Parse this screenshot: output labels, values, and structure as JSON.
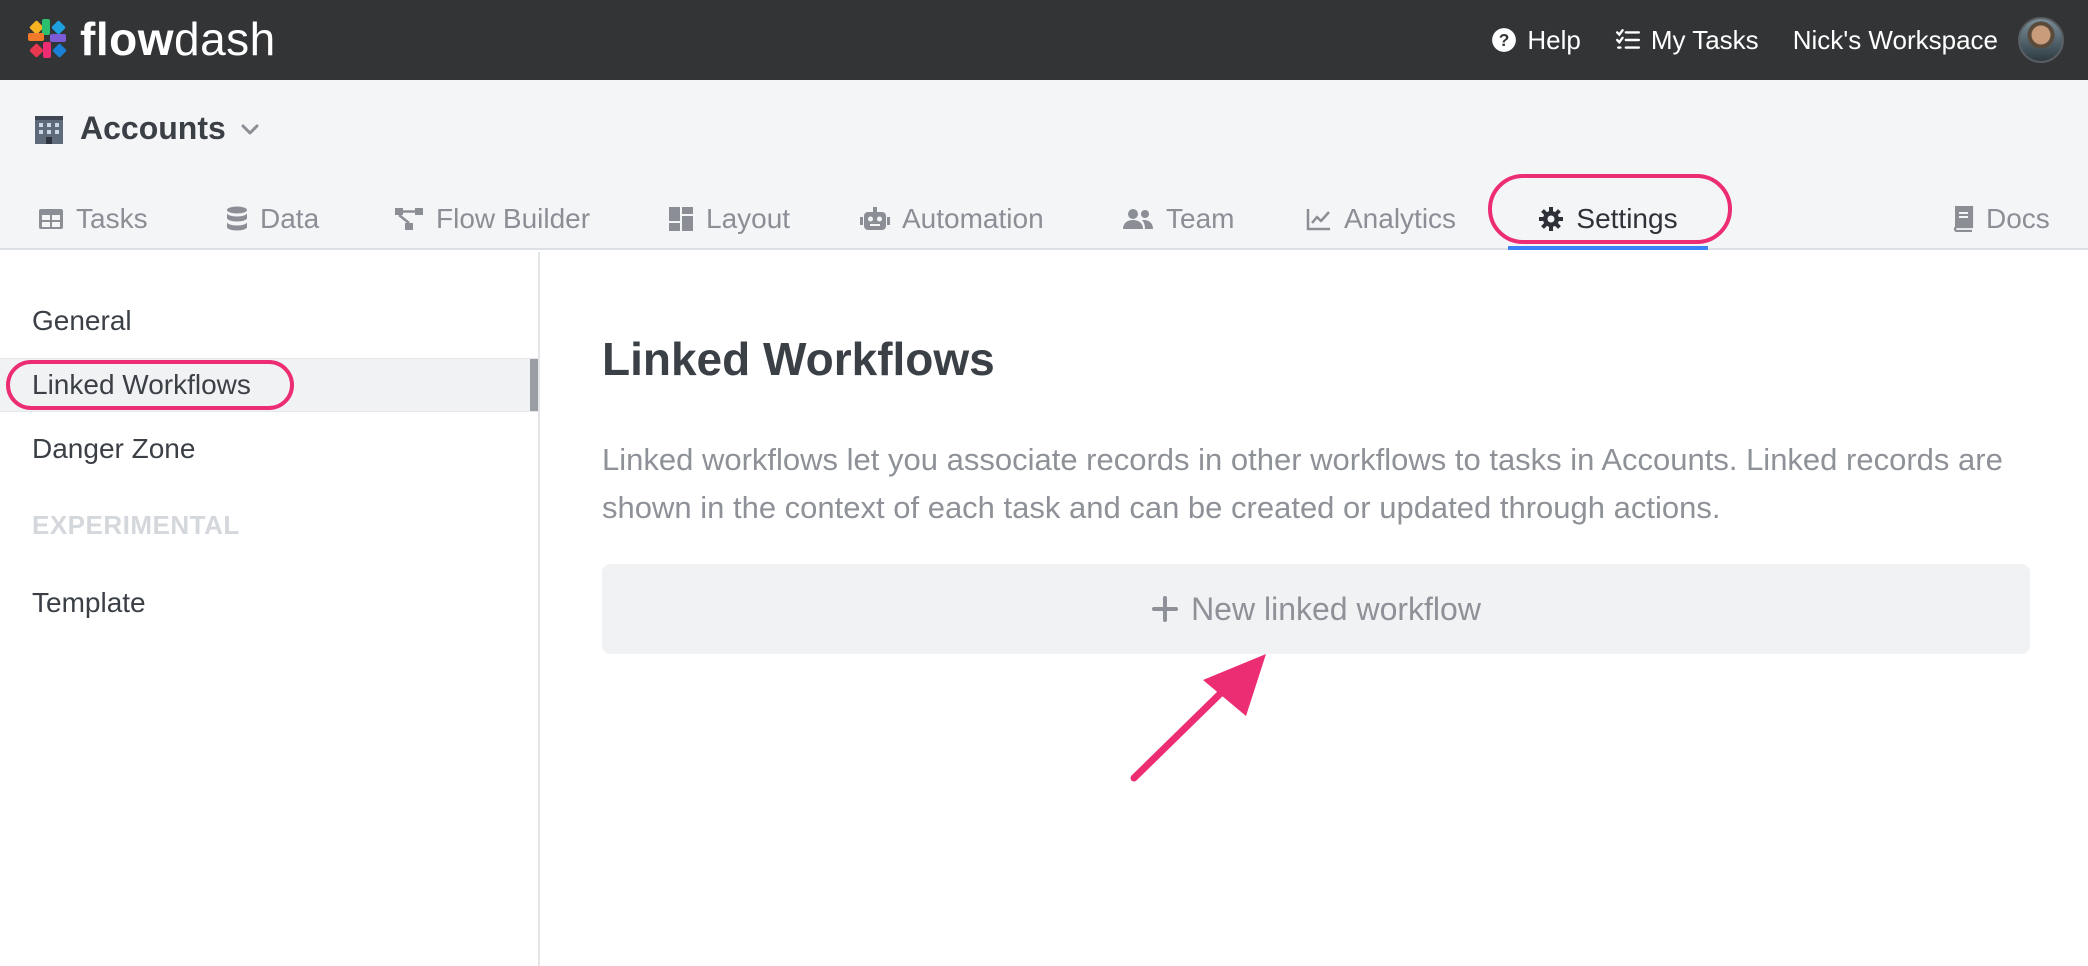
{
  "brand": {
    "bold": "flow",
    "light": "dash"
  },
  "topnav": {
    "help_label": "Help",
    "my_tasks_label": "My Tasks",
    "workspace_label": "Nick's Workspace"
  },
  "workflow": {
    "icon": "office-building-icon",
    "title": "Accounts"
  },
  "tabs": [
    {
      "label": "Tasks",
      "icon": "table-icon"
    },
    {
      "label": "Data",
      "icon": "database-icon"
    },
    {
      "label": "Flow Builder",
      "icon": "flow-icon"
    },
    {
      "label": "Layout",
      "icon": "layout-icon"
    },
    {
      "label": "Automation",
      "icon": "robot-icon"
    },
    {
      "label": "Team",
      "icon": "users-icon"
    },
    {
      "label": "Analytics",
      "icon": "chart-line-icon"
    },
    {
      "label": "Settings",
      "icon": "gear-icon",
      "active": true
    },
    {
      "label": "Docs",
      "icon": "book-icon"
    }
  ],
  "sidebar": {
    "items": [
      {
        "label": "General"
      },
      {
        "label": "Linked Workflows",
        "active": true
      },
      {
        "label": "Danger Zone"
      }
    ],
    "section_label": "EXPERIMENTAL",
    "experimental_items": [
      {
        "label": "Template"
      }
    ]
  },
  "main": {
    "title": "Linked Workflows",
    "description": "Linked workflows let you associate records in other workflows to tasks in Accounts. Linked records are shown in the context of each task and can be created or updated through actions.",
    "new_button_label": "New linked workflow"
  },
  "colors": {
    "topbar": "#323436",
    "annotation": "#ec2d73",
    "active_tab_underline": "#3b82f6"
  }
}
